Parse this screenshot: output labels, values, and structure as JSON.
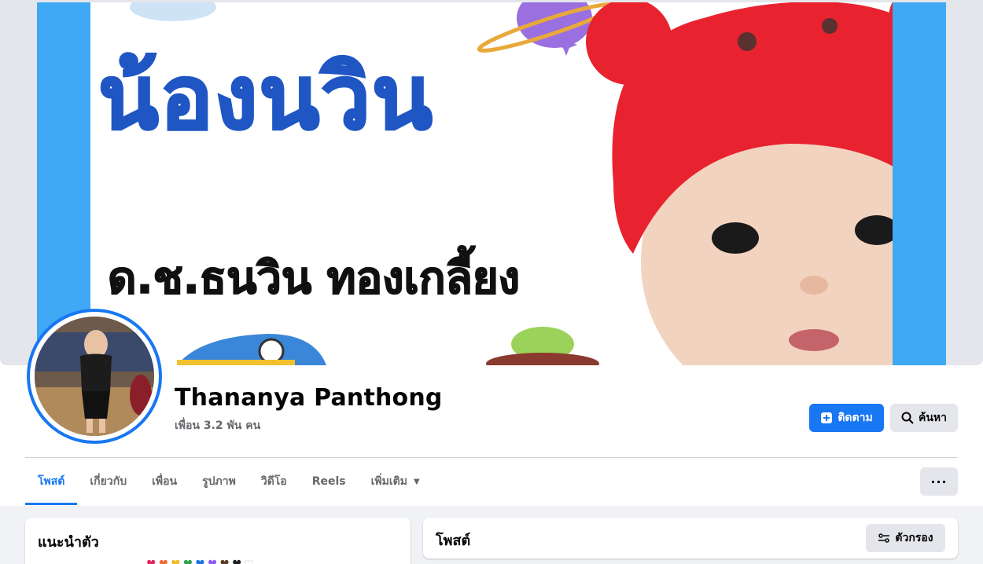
{
  "cover": {
    "title": "น้องนวิน",
    "subtitle": "ด.ช.ธนวิน ทองเกลี้ยง"
  },
  "profile": {
    "name": "Thananya Panthong",
    "friends": "เพื่อน 3.2 พัน คน"
  },
  "actions": {
    "follow_label": "ติดตาม",
    "search_label": "ค้นหา",
    "more_label": "···"
  },
  "tabs": [
    {
      "label": "โพสต์",
      "active": true
    },
    {
      "label": "เกี่ยวกับ",
      "active": false
    },
    {
      "label": "เพื่อน",
      "active": false
    },
    {
      "label": "รูปภาพ",
      "active": false
    },
    {
      "label": "วิดีโอ",
      "active": false
    },
    {
      "label": "Reels",
      "active": false
    },
    {
      "label": "เพิ่มเติม",
      "active": false
    }
  ],
  "intro": {
    "title": "แนะนำตัว",
    "hearts": [
      "♥",
      "♥",
      "♥",
      "♥",
      "♥",
      "♥",
      "♥",
      "♥",
      "♡"
    ]
  },
  "posts": {
    "title": "โพสต์",
    "filter_label": "ตัวกรอง"
  },
  "colors": {
    "accent": "#1877f2",
    "cover_blue": "#1f56c4",
    "hat_red": "#e8232f",
    "hearts": [
      "#e0245e",
      "#f26b3a",
      "#f7b928",
      "#31a24c",
      "#1b74e4",
      "#8b5cf6",
      "#5b3a29",
      "#1c1e21",
      "#ffffff"
    ]
  }
}
